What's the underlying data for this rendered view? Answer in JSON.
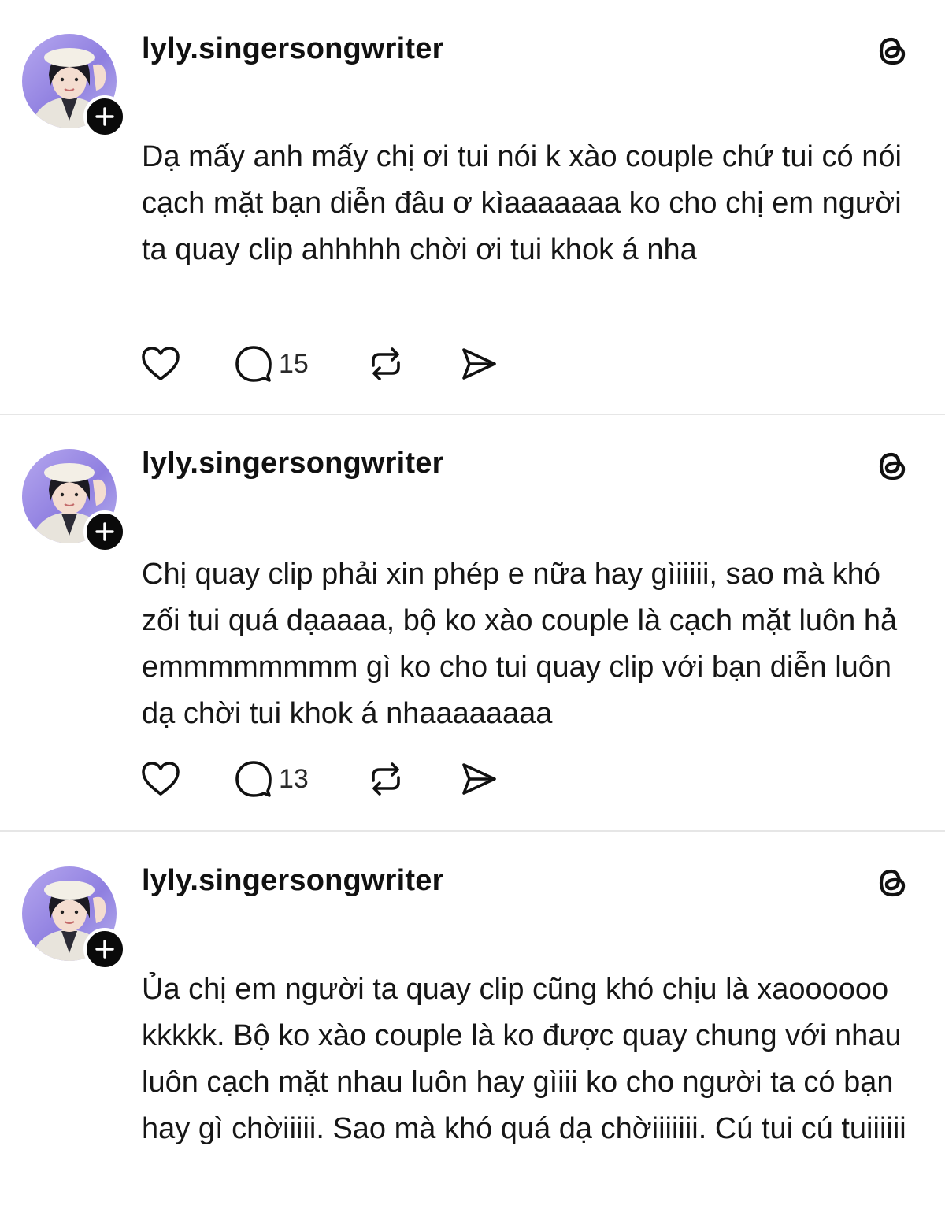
{
  "posts": [
    {
      "username": "lyly.singersongwriter",
      "text": "Dạ mấy anh mấy chị ơi tui nói k xào couple chứ tui có nói cạch mặt bạn diễn đâu ơ kìaaaaaaa ko cho chị em người ta quay clip ahhhhh chời ơi tui khok á nha",
      "comment_count": "15"
    },
    {
      "username": "lyly.singersongwriter",
      "text": "Chị quay clip phải xin phép e nữa hay gìiiiii, sao mà khó zối tui quá dạaaaa, bộ ko xào couple là cạch mặt luôn hả emmmmmmmm gì ko cho tui quay clip với bạn diễn luôn dạ chời tui khok á nhaaaaaaaa",
      "comment_count": "13"
    },
    {
      "username": "lyly.singersongwriter",
      "text": "Ủa chị em người ta quay clip cũng khó chịu là xaoooooo kkkkk. Bộ ko xào couple là ko được quay chung với nhau luôn cạch mặt nhau luôn hay gìiii ko cho người ta có bạn hay gì chờiiiii. Sao mà khó quá dạ chờiiiiiii. Cú tui cú tuiiiiii"
    }
  ],
  "icons": {
    "like": "heart-icon",
    "comment": "comment-bubble-icon",
    "repost": "repost-icon",
    "share": "send-icon",
    "follow": "plus-icon",
    "brand": "threads-logo-icon"
  },
  "colors": {
    "background": "#ffffff",
    "text": "#161616",
    "divider": "#e6e6e6",
    "badge": "#0a0a0a",
    "avatar_bg": "#9a8ae4"
  }
}
